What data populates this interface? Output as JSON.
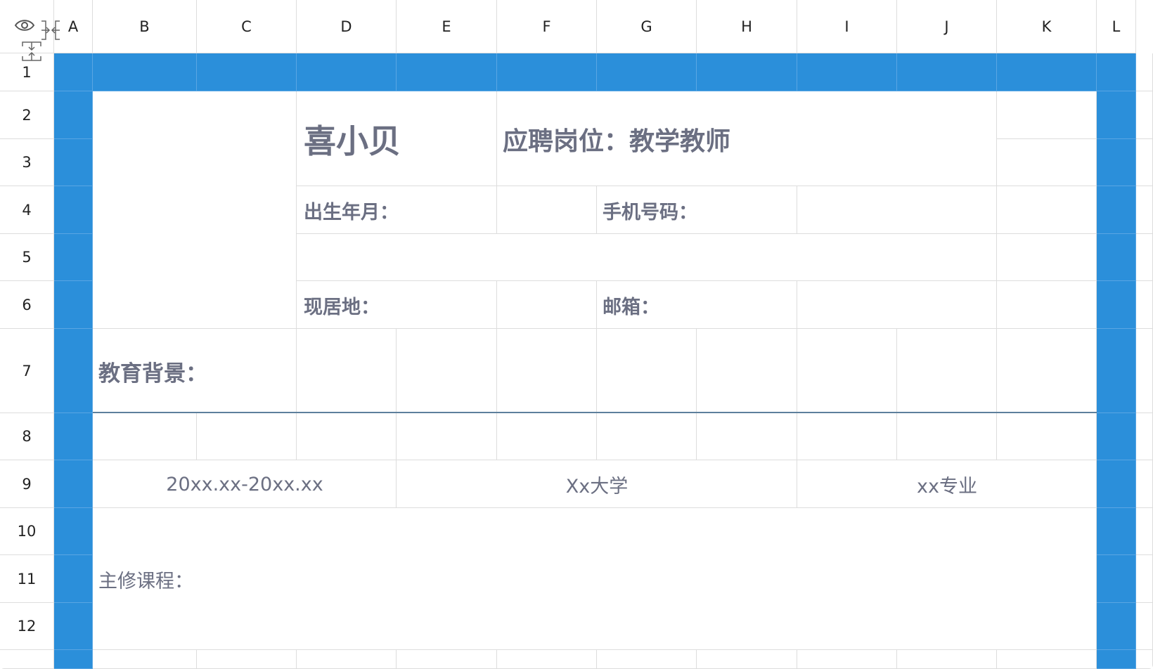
{
  "columns": [
    "A",
    "B",
    "C",
    "D",
    "E",
    "F",
    "G",
    "H",
    "I",
    "J",
    "K",
    "L"
  ],
  "rows": [
    "1",
    "2",
    "3",
    "4",
    "5",
    "6",
    "7",
    "8",
    "9",
    "10",
    "11",
    "12"
  ],
  "toolbar": {
    "icons": [
      "eye-icon",
      "collapse-columns-icon",
      "collapse-rows-icon"
    ]
  },
  "resume": {
    "name": "喜小贝",
    "position": "应聘岗位：教学教师",
    "birth_label": "出生年月：",
    "phone_label": "手机号码：",
    "address_label": "现居地：",
    "email_label": "邮箱：",
    "education_label": "教育背景：",
    "edu_date": "20xx.xx-20xx.xx",
    "edu_school": "Xx大学",
    "edu_major": "xx专业",
    "courses_label": "主修课程："
  },
  "colors": {
    "accent_blue": "#2b8fda",
    "text_gray": "#6b6f82",
    "grid": "#dddddd"
  }
}
